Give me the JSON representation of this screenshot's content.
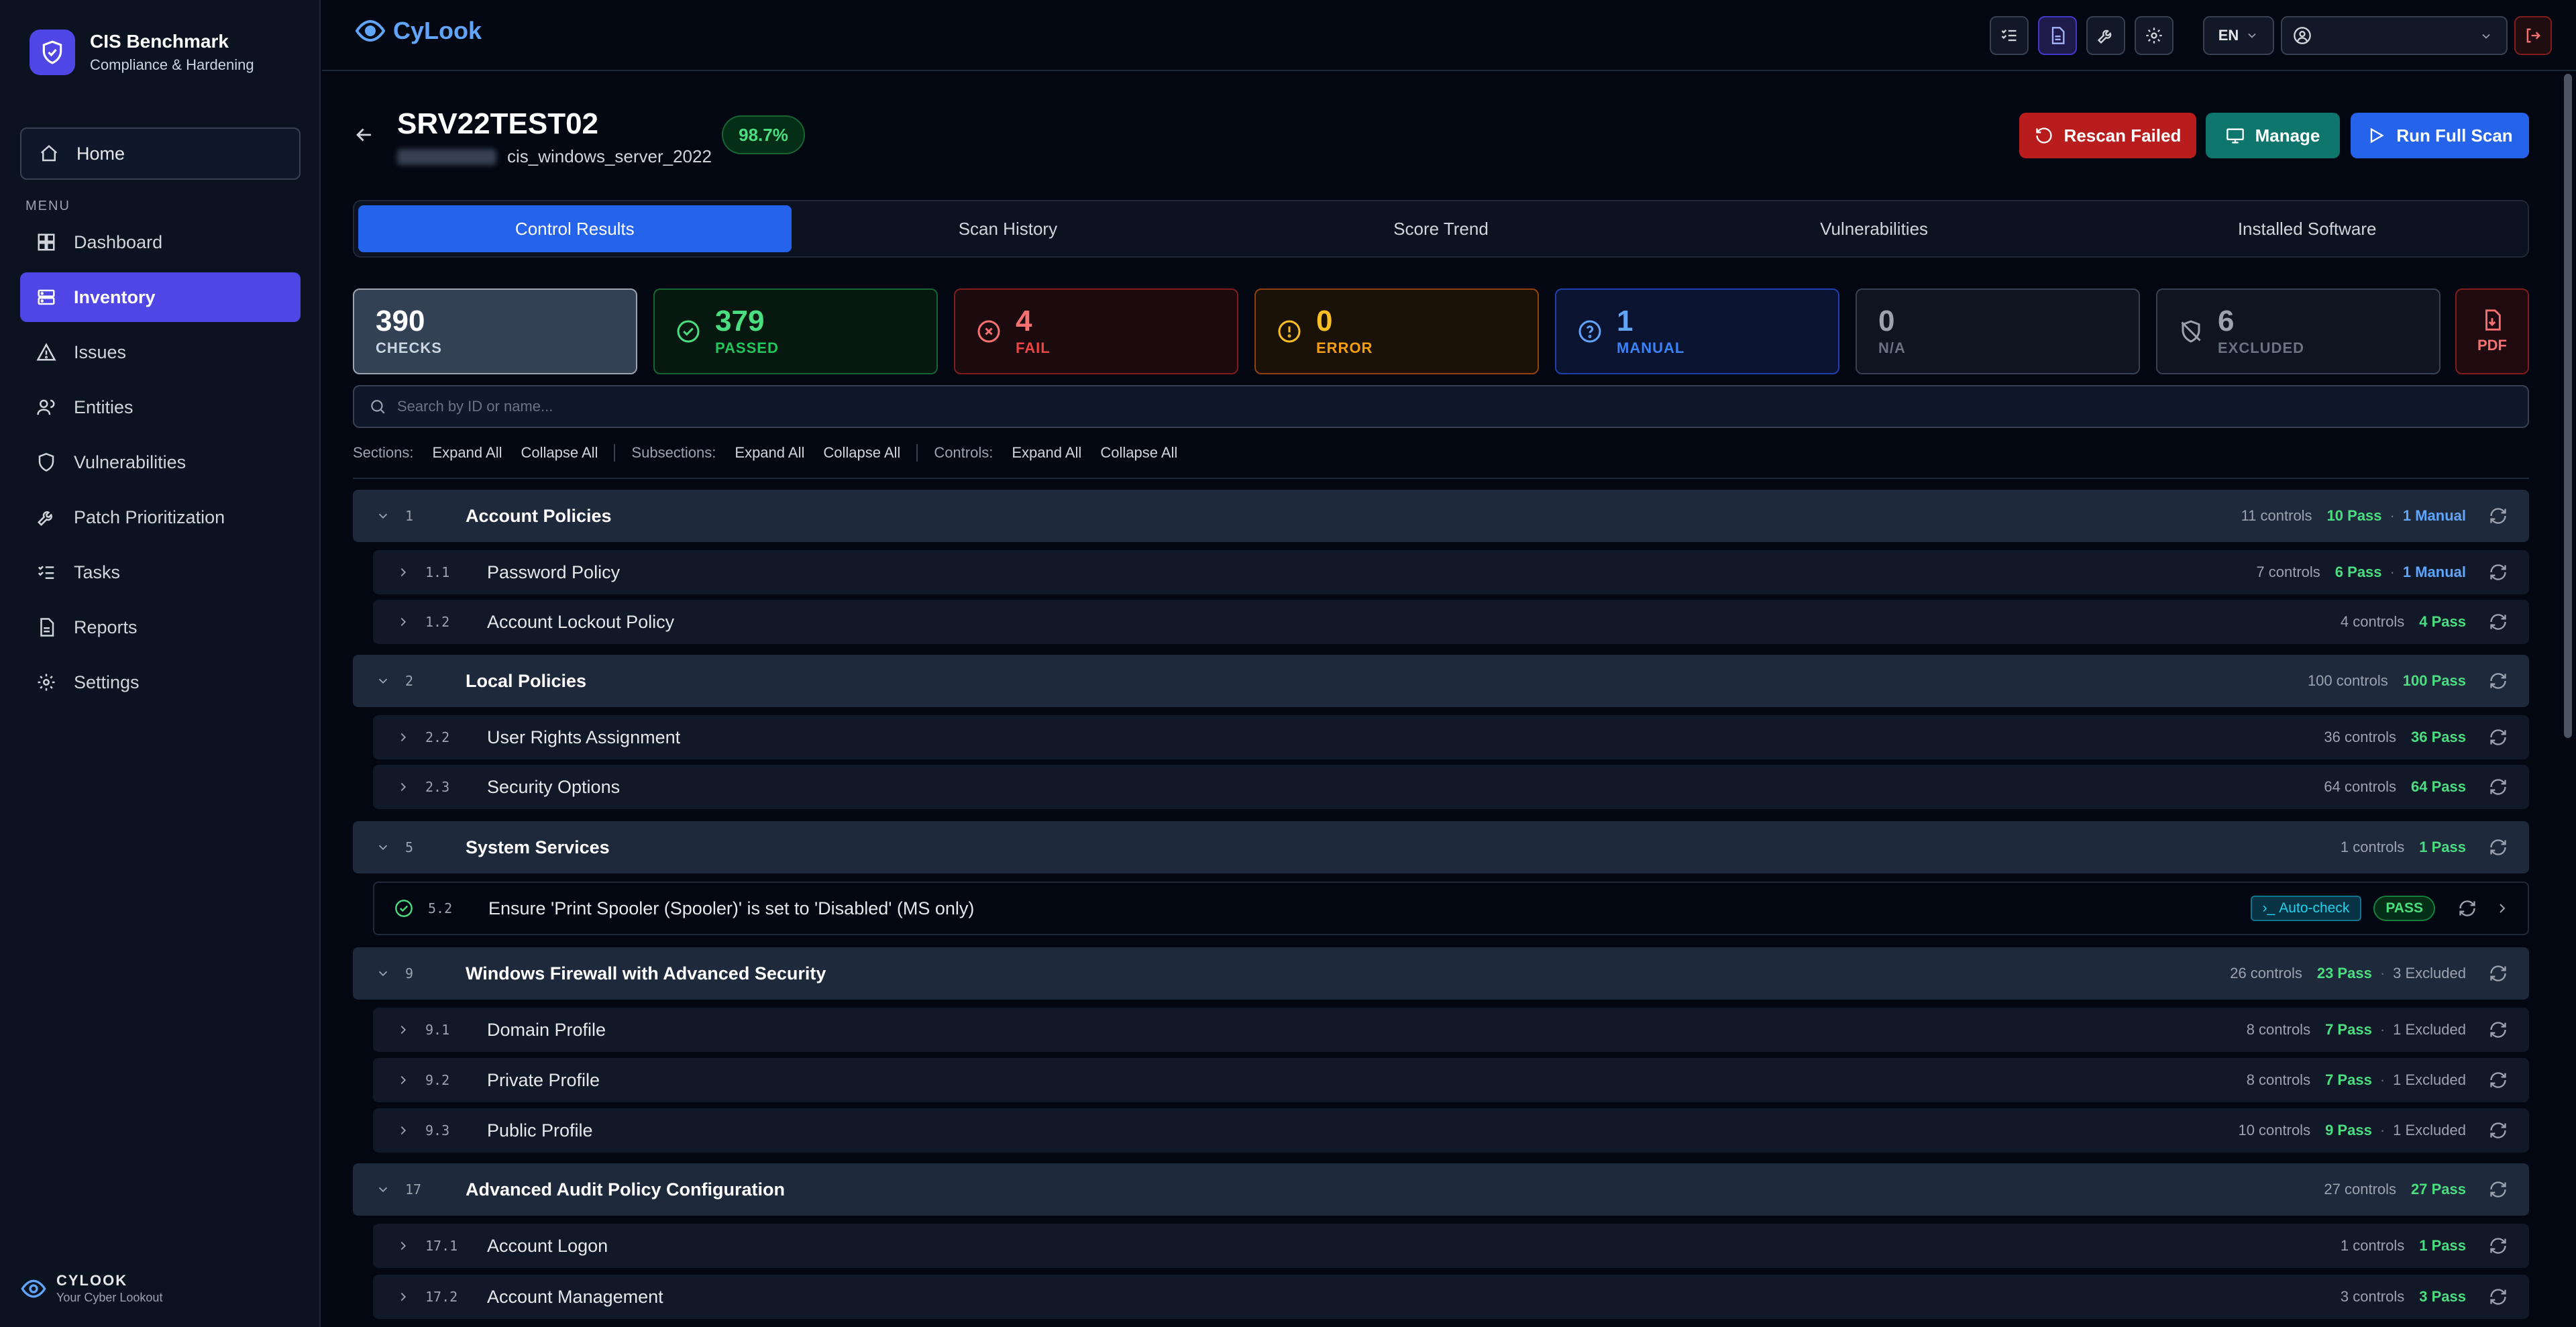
{
  "sidebar": {
    "brand_title": "CIS Benchmark",
    "brand_subtitle": "Compliance & Hardening",
    "home_label": "Home",
    "menu_label": "MENU",
    "items": [
      {
        "label": "Dashboard",
        "icon": "grid-icon"
      },
      {
        "label": "Inventory",
        "icon": "server-icon",
        "active": true
      },
      {
        "label": "Issues",
        "icon": "warning-icon"
      },
      {
        "label": "Entities",
        "icon": "users-icon"
      },
      {
        "label": "Vulnerabilities",
        "icon": "shield-icon"
      },
      {
        "label": "Patch Prioritization",
        "icon": "wrench-icon"
      },
      {
        "label": "Tasks",
        "icon": "tasks-icon"
      },
      {
        "label": "Reports",
        "icon": "report-icon"
      },
      {
        "label": "Settings",
        "icon": "gear-icon"
      }
    ],
    "footer_title": "CYLOOK",
    "footer_subtitle": "Your Cyber Lookout"
  },
  "topbar": {
    "logo_text": "CyLook",
    "language": "EN"
  },
  "header": {
    "hostname": "SRV22TEST02",
    "benchmark": "cis_windows_server_2022",
    "score": "98.7%",
    "rescan_label": "Rescan Failed",
    "manage_label": "Manage",
    "full_scan_label": "Run Full Scan"
  },
  "tabs": [
    "Control Results",
    "Scan History",
    "Score Trend",
    "Vulnerabilities",
    "Installed Software"
  ],
  "stats": {
    "checks": {
      "value": "390",
      "label": "CHECKS"
    },
    "passed": {
      "value": "379",
      "label": "PASSED"
    },
    "fail": {
      "value": "4",
      "label": "FAIL"
    },
    "error": {
      "value": "0",
      "label": "ERROR"
    },
    "manual": {
      "value": "1",
      "label": "MANUAL"
    },
    "na": {
      "value": "0",
      "label": "N/A"
    },
    "excluded": {
      "value": "6",
      "label": "EXCLUDED"
    },
    "pdf_label": "PDF"
  },
  "colors": {
    "accent": "#2563eb",
    "sidebar_active": "#4f46e5",
    "pass": "#4ade80",
    "fail": "#f87171",
    "error": "#fbbf24",
    "manual": "#60a5fa"
  },
  "search": {
    "placeholder": "Search by ID or name..."
  },
  "expand_bar": {
    "sections_label": "Sections:",
    "subsections_label": "Subsections:",
    "controls_label": "Controls:",
    "expand_all": "Expand All",
    "collapse_all": "Collapse All"
  },
  "tree": [
    {
      "kind": "section",
      "id": "1",
      "title": "Account Policies",
      "controls": "11 controls",
      "pass": "10 Pass",
      "manual": "1 Manual"
    },
    {
      "kind": "sub",
      "id": "1.1",
      "title": "Password Policy",
      "controls": "7 controls",
      "pass": "6 Pass",
      "manual": "1 Manual"
    },
    {
      "kind": "sub",
      "id": "1.2",
      "title": "Account Lockout Policy",
      "controls": "4 controls",
      "pass": "4 Pass"
    },
    {
      "kind": "section",
      "id": "2",
      "title": "Local Policies",
      "controls": "100 controls",
      "pass": "100 Pass"
    },
    {
      "kind": "sub",
      "id": "2.2",
      "title": "User Rights Assignment",
      "controls": "36 controls",
      "pass": "36 Pass"
    },
    {
      "kind": "sub",
      "id": "2.3",
      "title": "Security Options",
      "controls": "64 controls",
      "pass": "64 Pass"
    },
    {
      "kind": "section",
      "id": "5",
      "title": "System Services",
      "controls": "1 controls",
      "pass": "1 Pass"
    },
    {
      "kind": "control",
      "id": "5.2",
      "title": "Ensure 'Print Spooler (Spooler)' is set to 'Disabled' (MS only)",
      "auto_label": "Auto-check",
      "status": "PASS"
    },
    {
      "kind": "section",
      "id": "9",
      "title": "Windows Firewall with Advanced Security",
      "controls": "26 controls",
      "pass": "23 Pass",
      "excluded": "3 Excluded"
    },
    {
      "kind": "sub",
      "id": "9.1",
      "title": "Domain Profile",
      "controls": "8 controls",
      "pass": "7 Pass",
      "excluded": "1 Excluded"
    },
    {
      "kind": "sub",
      "id": "9.2",
      "title": "Private Profile",
      "controls": "8 controls",
      "pass": "7 Pass",
      "excluded": "1 Excluded"
    },
    {
      "kind": "sub",
      "id": "9.3",
      "title": "Public Profile",
      "controls": "10 controls",
      "pass": "9 Pass",
      "excluded": "1 Excluded"
    },
    {
      "kind": "section",
      "id": "17",
      "title": "Advanced Audit Policy Configuration",
      "controls": "27 controls",
      "pass": "27 Pass"
    },
    {
      "kind": "sub",
      "id": "17.1",
      "title": "Account Logon",
      "controls": "1 controls",
      "pass": "1 Pass"
    },
    {
      "kind": "sub",
      "id": "17.2",
      "title": "Account Management",
      "controls": "3 controls",
      "pass": "3 Pass"
    }
  ]
}
